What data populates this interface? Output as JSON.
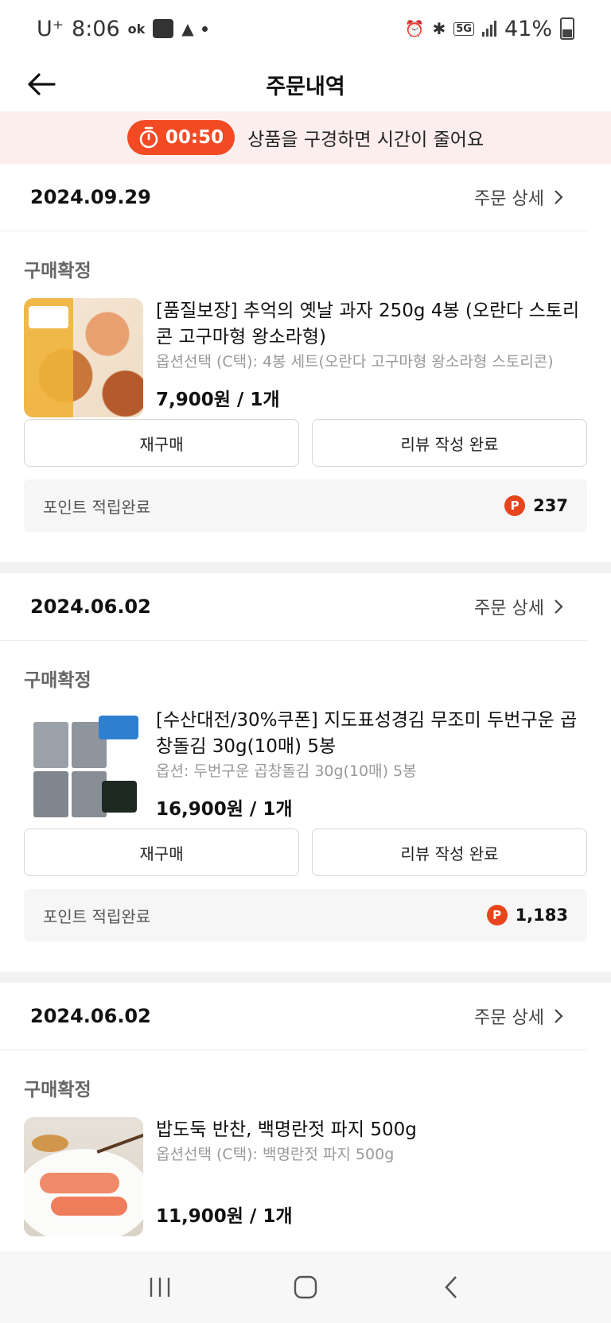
{
  "status_bar": {
    "carrier": "U⁺",
    "time": "8:06",
    "ok_icon_text": "ok",
    "battery": "41%",
    "network": "5G"
  },
  "header": {
    "title": "주문내역"
  },
  "banner": {
    "timer": "00:50",
    "text": "상품을 구경하면 시간이 줄어요"
  },
  "orders": [
    {
      "date": "2024.09.29",
      "detail_label": "주문 상세",
      "status": "구매확정",
      "product_name": "[품질보장] 추억의 옛날 과자 250g 4봉 (오란다 스토리콘 고구마형 왕소라형)",
      "option": "옵션선택 (C택): 4봉 세트(오란다 고구마형 왕소라형 스토리콘)",
      "price": "7,900원 / 1개",
      "rebuy_label": "재구매",
      "review_label": "리뷰 작성 완료",
      "point_label": "포인트 적립완료",
      "point_badge": "P",
      "point_value": "237"
    },
    {
      "date": "2024.06.02",
      "detail_label": "주문 상세",
      "status": "구매확정",
      "product_name": "[수산대전/30%쿠폰] 지도표성경김 무조미 두번구운 곱창돌김 30g(10매) 5봉",
      "option": "옵션: 두번구운 곱창돌김 30g(10매) 5봉",
      "price": "16,900원 / 1개",
      "rebuy_label": "재구매",
      "review_label": "리뷰 작성 완료",
      "point_label": "포인트 적립완료",
      "point_badge": "P",
      "point_value": "1,183"
    },
    {
      "date": "2024.06.02",
      "detail_label": "주문 상세",
      "status": "구매확정",
      "product_name": "밥도둑 반찬, 백명란젓 파지 500g",
      "option": "옵션선택 (C택): 백명란젓 파지 500g",
      "price": "11,900원 / 1개"
    }
  ],
  "colors": {
    "accent": "#f24b24",
    "banner_bg": "#fdeeee",
    "point_badge": "#e8451c"
  }
}
